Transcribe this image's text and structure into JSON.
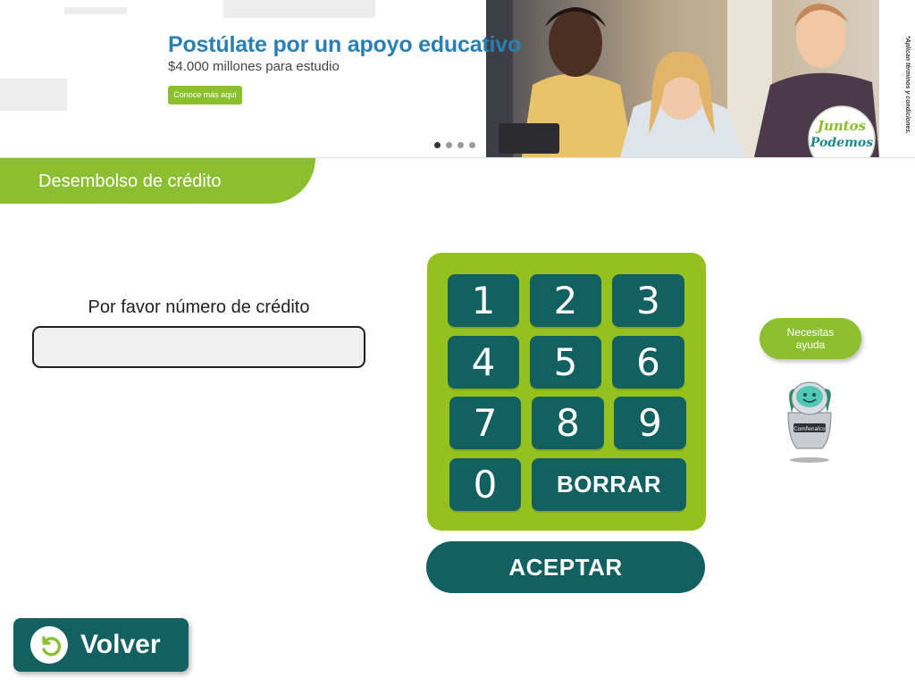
{
  "banner": {
    "title": "Postúlate por un apoyo educativo",
    "subtitle": "$4.000 millones para estudio",
    "cta_label": "Conoce más aquí",
    "disclaimer": "*Aplican términos y condiciones.",
    "logo_text_top": "Juntos",
    "logo_text_bottom": "Podemos",
    "slides_total": 4,
    "active_slide": 1
  },
  "section": {
    "title": "Desembolso de crédito"
  },
  "form": {
    "prompt": "Por favor número de crédito",
    "input_value": "",
    "input_placeholder": ""
  },
  "keypad": {
    "keys": [
      "1",
      "2",
      "3",
      "4",
      "5",
      "6",
      "7",
      "8",
      "9",
      "0"
    ],
    "delete_label": "BORRAR",
    "accept_label": "ACEPTAR"
  },
  "help": {
    "label": "Necesitas ayuda",
    "robot_badge": "Comfenalco"
  },
  "navigation": {
    "back_label": "Volver"
  },
  "colors": {
    "brand_green": "#8cbf2f",
    "keypad_green": "#95c11f",
    "teal": "#12605f",
    "banner_blue": "#2a7fb5"
  },
  "icons": {
    "back": "undo-arrow-icon",
    "assistant": "robot-assistant-icon"
  }
}
